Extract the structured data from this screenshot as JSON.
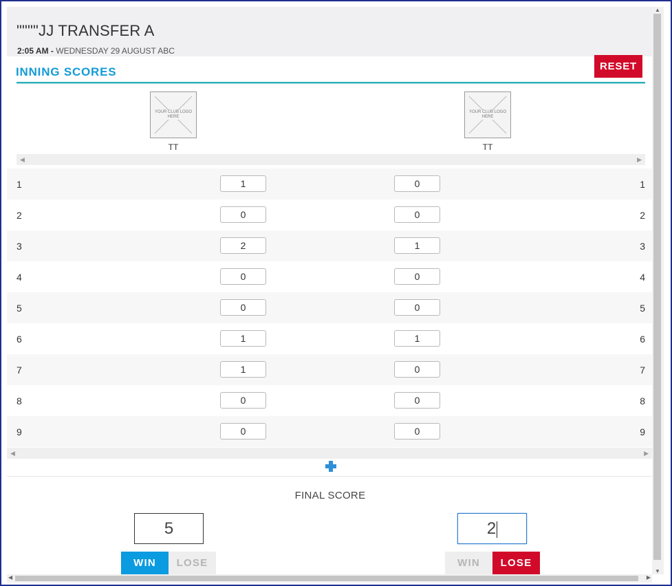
{
  "header": {
    "title": "\"\"\"\"JJ TRANSFER A",
    "time": "2:05 AM -",
    "date": "WEDNESDAY 29 AUGUST ABC"
  },
  "section_title": "INNING SCORES",
  "reset_label": "RESET",
  "teams": [
    {
      "logo_text": "YOUR CLUB LOGO HERE",
      "name": "TT"
    },
    {
      "logo_text": "YOUR CLUB LOGO HERE",
      "name": "TT"
    }
  ],
  "innings": [
    {
      "number": "1",
      "team_a": "1",
      "team_b": "0"
    },
    {
      "number": "2",
      "team_a": "0",
      "team_b": "0"
    },
    {
      "number": "3",
      "team_a": "2",
      "team_b": "1"
    },
    {
      "number": "4",
      "team_a": "0",
      "team_b": "0"
    },
    {
      "number": "5",
      "team_a": "0",
      "team_b": "0"
    },
    {
      "number": "6",
      "team_a": "1",
      "team_b": "1"
    },
    {
      "number": "7",
      "team_a": "1",
      "team_b": "0"
    },
    {
      "number": "8",
      "team_a": "0",
      "team_b": "0"
    },
    {
      "number": "9",
      "team_a": "0",
      "team_b": "0"
    }
  ],
  "final": {
    "label": "FINAL SCORE",
    "team_a_score": "5",
    "team_b_score": "2",
    "win_label": "WIN",
    "lose_label": "LOSE",
    "team_a_result": "win",
    "team_b_result": "lose"
  },
  "colors": {
    "accent_blue": "#139bd6",
    "win_blue": "#0a9be0",
    "lose_red": "#d20a2a",
    "teal_rule": "#2ab0b7"
  },
  "icons": {
    "add": "plus-icon",
    "logo": "logo-placeholder-icon"
  }
}
